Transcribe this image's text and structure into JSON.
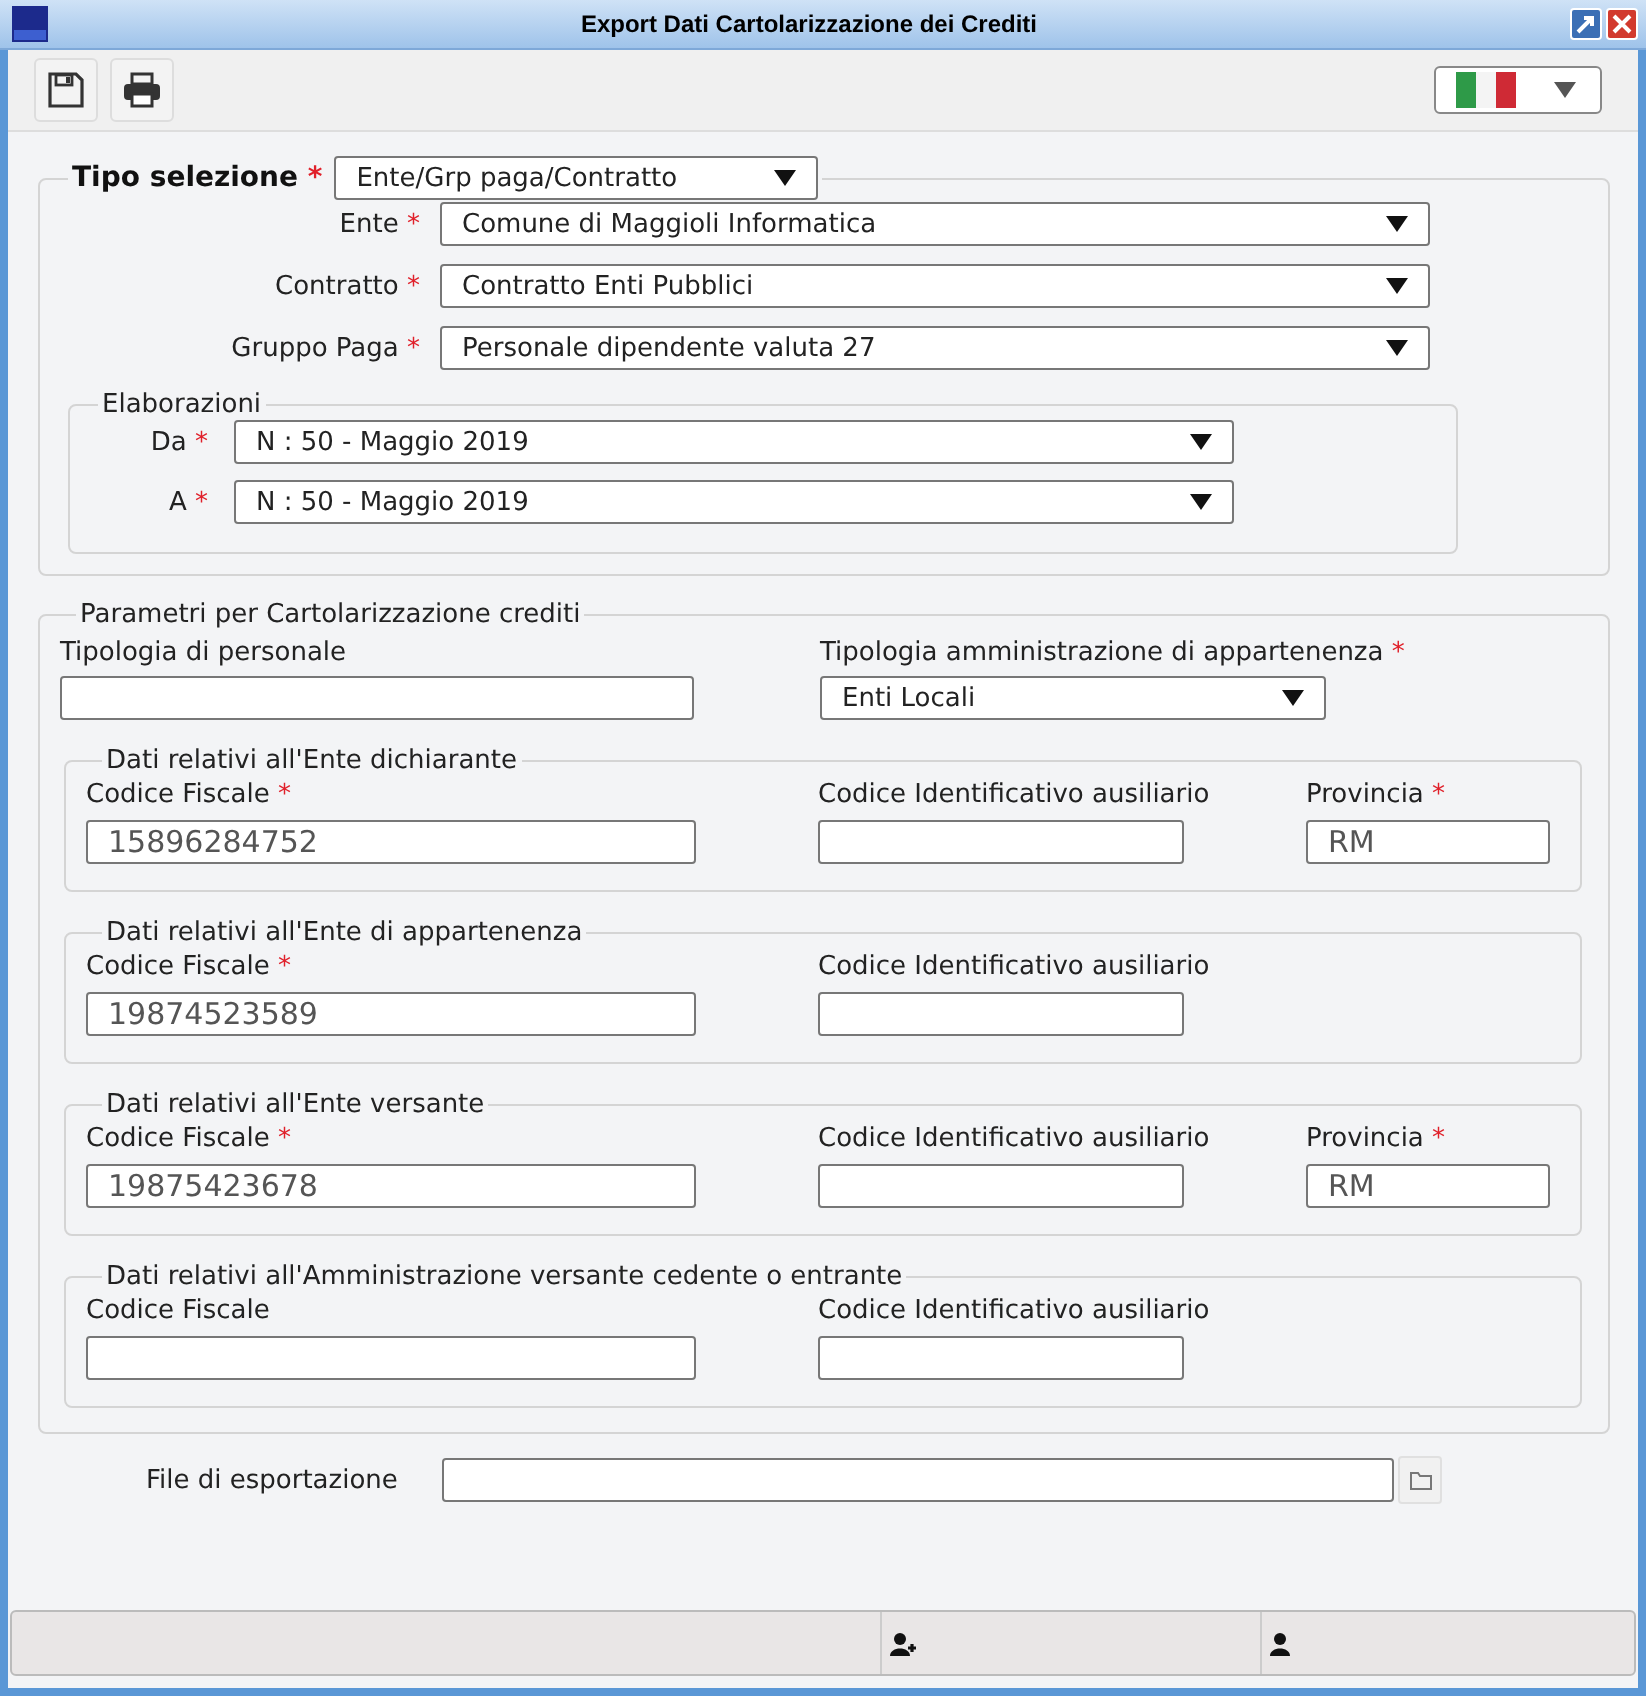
{
  "window": {
    "title": "Export Dati Cartolarizzazione dei Crediti"
  },
  "toolbar": {
    "buttons": [
      {
        "kind": "save"
      },
      {
        "kind": "print"
      }
    ]
  },
  "selection": {
    "label": "Tipo selezione",
    "mark": "*",
    "value": "Ente/Grp paga/Contratto",
    "rows": [
      {
        "label": "Ente",
        "mark": "*",
        "value": "Comune di Maggioli Informatica"
      },
      {
        "label": "Contratto",
        "mark": "*",
        "value": "Contratto Enti Pubblici"
      },
      {
        "label": "Gruppo Paga",
        "mark": "*",
        "value": "Personale dipendente valuta 27"
      }
    ],
    "elaborazioni": {
      "legend": "Elaborazioni",
      "rows": [
        {
          "label": "Da",
          "mark": "*",
          "value": "N : 50 - Maggio 2019"
        },
        {
          "label": "A",
          "mark": "*",
          "value": "N : 50 - Maggio 2019"
        }
      ]
    }
  },
  "parameters": {
    "legend": "Parametri per Cartolarizzazione crediti",
    "fields": [
      {
        "kind": "text",
        "label": "Tipologia di personale"
      },
      {
        "kind": "select",
        "label": "Tipologia amministrazione di appartenenza",
        "mark": "*",
        "value": "Enti Locali"
      }
    ],
    "sections": [
      {
        "legend": "Dati relativi all'Ente dichiarante",
        "fields": [
          {
            "label": "Codice Fiscale",
            "mark": "*",
            "value": "15896284752"
          },
          {
            "label": "Codice Identificativo ausiliario"
          },
          {
            "label": "Provincia",
            "mark": "*",
            "value": "RM"
          }
        ]
      },
      {
        "legend": "Dati relativi all'Ente di appartenenza",
        "fields": [
          {
            "label": "Codice Fiscale",
            "mark": "*",
            "value": "19874523589"
          },
          {
            "label": "Codice Identificativo ausiliario"
          }
        ]
      },
      {
        "legend": "Dati relativi all'Ente versante",
        "fields": [
          {
            "label": "Codice Fiscale",
            "mark": "*",
            "value": "19875423678"
          },
          {
            "label": "Codice Identificativo ausiliario"
          },
          {
            "label": "Provincia",
            "mark": "*",
            "value": "RM"
          }
        ]
      },
      {
        "legend": "Dati relativi all'Amministrazione versante cedente o entrante",
        "fields": [
          {
            "label": "Codice Fiscale"
          },
          {
            "label": "Codice Identificativo ausiliario"
          }
        ]
      }
    ]
  },
  "export_file": {
    "label": "File di esportazione"
  },
  "status_bar": [
    {
      "kind": "plain"
    },
    {
      "kind": "user-add"
    },
    {
      "kind": "user"
    }
  ]
}
